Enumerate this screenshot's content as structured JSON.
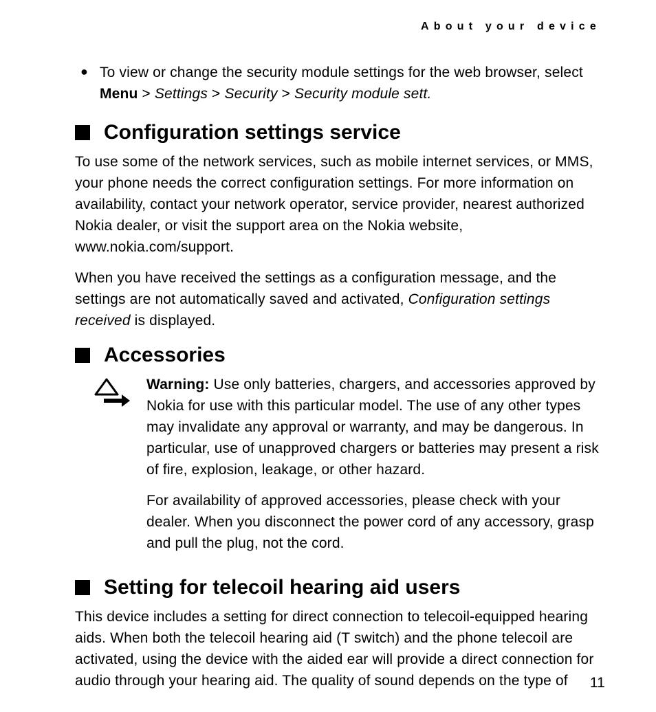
{
  "running_head": "About your device",
  "page_number": "11",
  "bullet": {
    "pre": "To view or change the security module settings for the web browser, select ",
    "menu": "Menu",
    "sep1": " > ",
    "seg1": "Settings",
    "sep2": " > ",
    "seg2": "Security",
    "sep3": " > ",
    "seg3": "Security module sett.",
    "post": ""
  },
  "config": {
    "heading": "Configuration settings service",
    "p1": "To use some of the network services, such as mobile internet services, or MMS, your phone needs the correct configuration settings. For more information on availability, contact your network operator, service provider, nearest authorized Nokia dealer, or visit the support area on the Nokia website, www.nokia.com/support.",
    "p2_pre": "When you have received the settings as a configuration message, and the settings are not automatically saved and activated, ",
    "p2_italic": "Configuration settings received",
    "p2_post": " is displayed."
  },
  "accessories": {
    "heading": "Accessories",
    "warning_label": "Warning:",
    "warning_text": " Use only batteries, chargers, and accessories approved by Nokia for use with this particular model. The use of any other types may invalidate any approval or warranty, and may be dangerous. In particular, use of unapproved chargers or batteries may present a risk of fire, explosion, leakage, or other hazard.",
    "p2": "For availability of approved accessories, please check with your dealer. When you disconnect the power cord of any accessory, grasp and pull the plug, not the cord."
  },
  "telecoil": {
    "heading": "Setting for telecoil hearing aid users",
    "p1": "This device includes a setting for direct connection to telecoil-equipped hearing aids. When both the telecoil hearing aid (T switch) and the phone telecoil are activated, using the device with the aided ear will provide a direct connection for audio through your hearing aid. The quality of sound depends on the type of"
  }
}
